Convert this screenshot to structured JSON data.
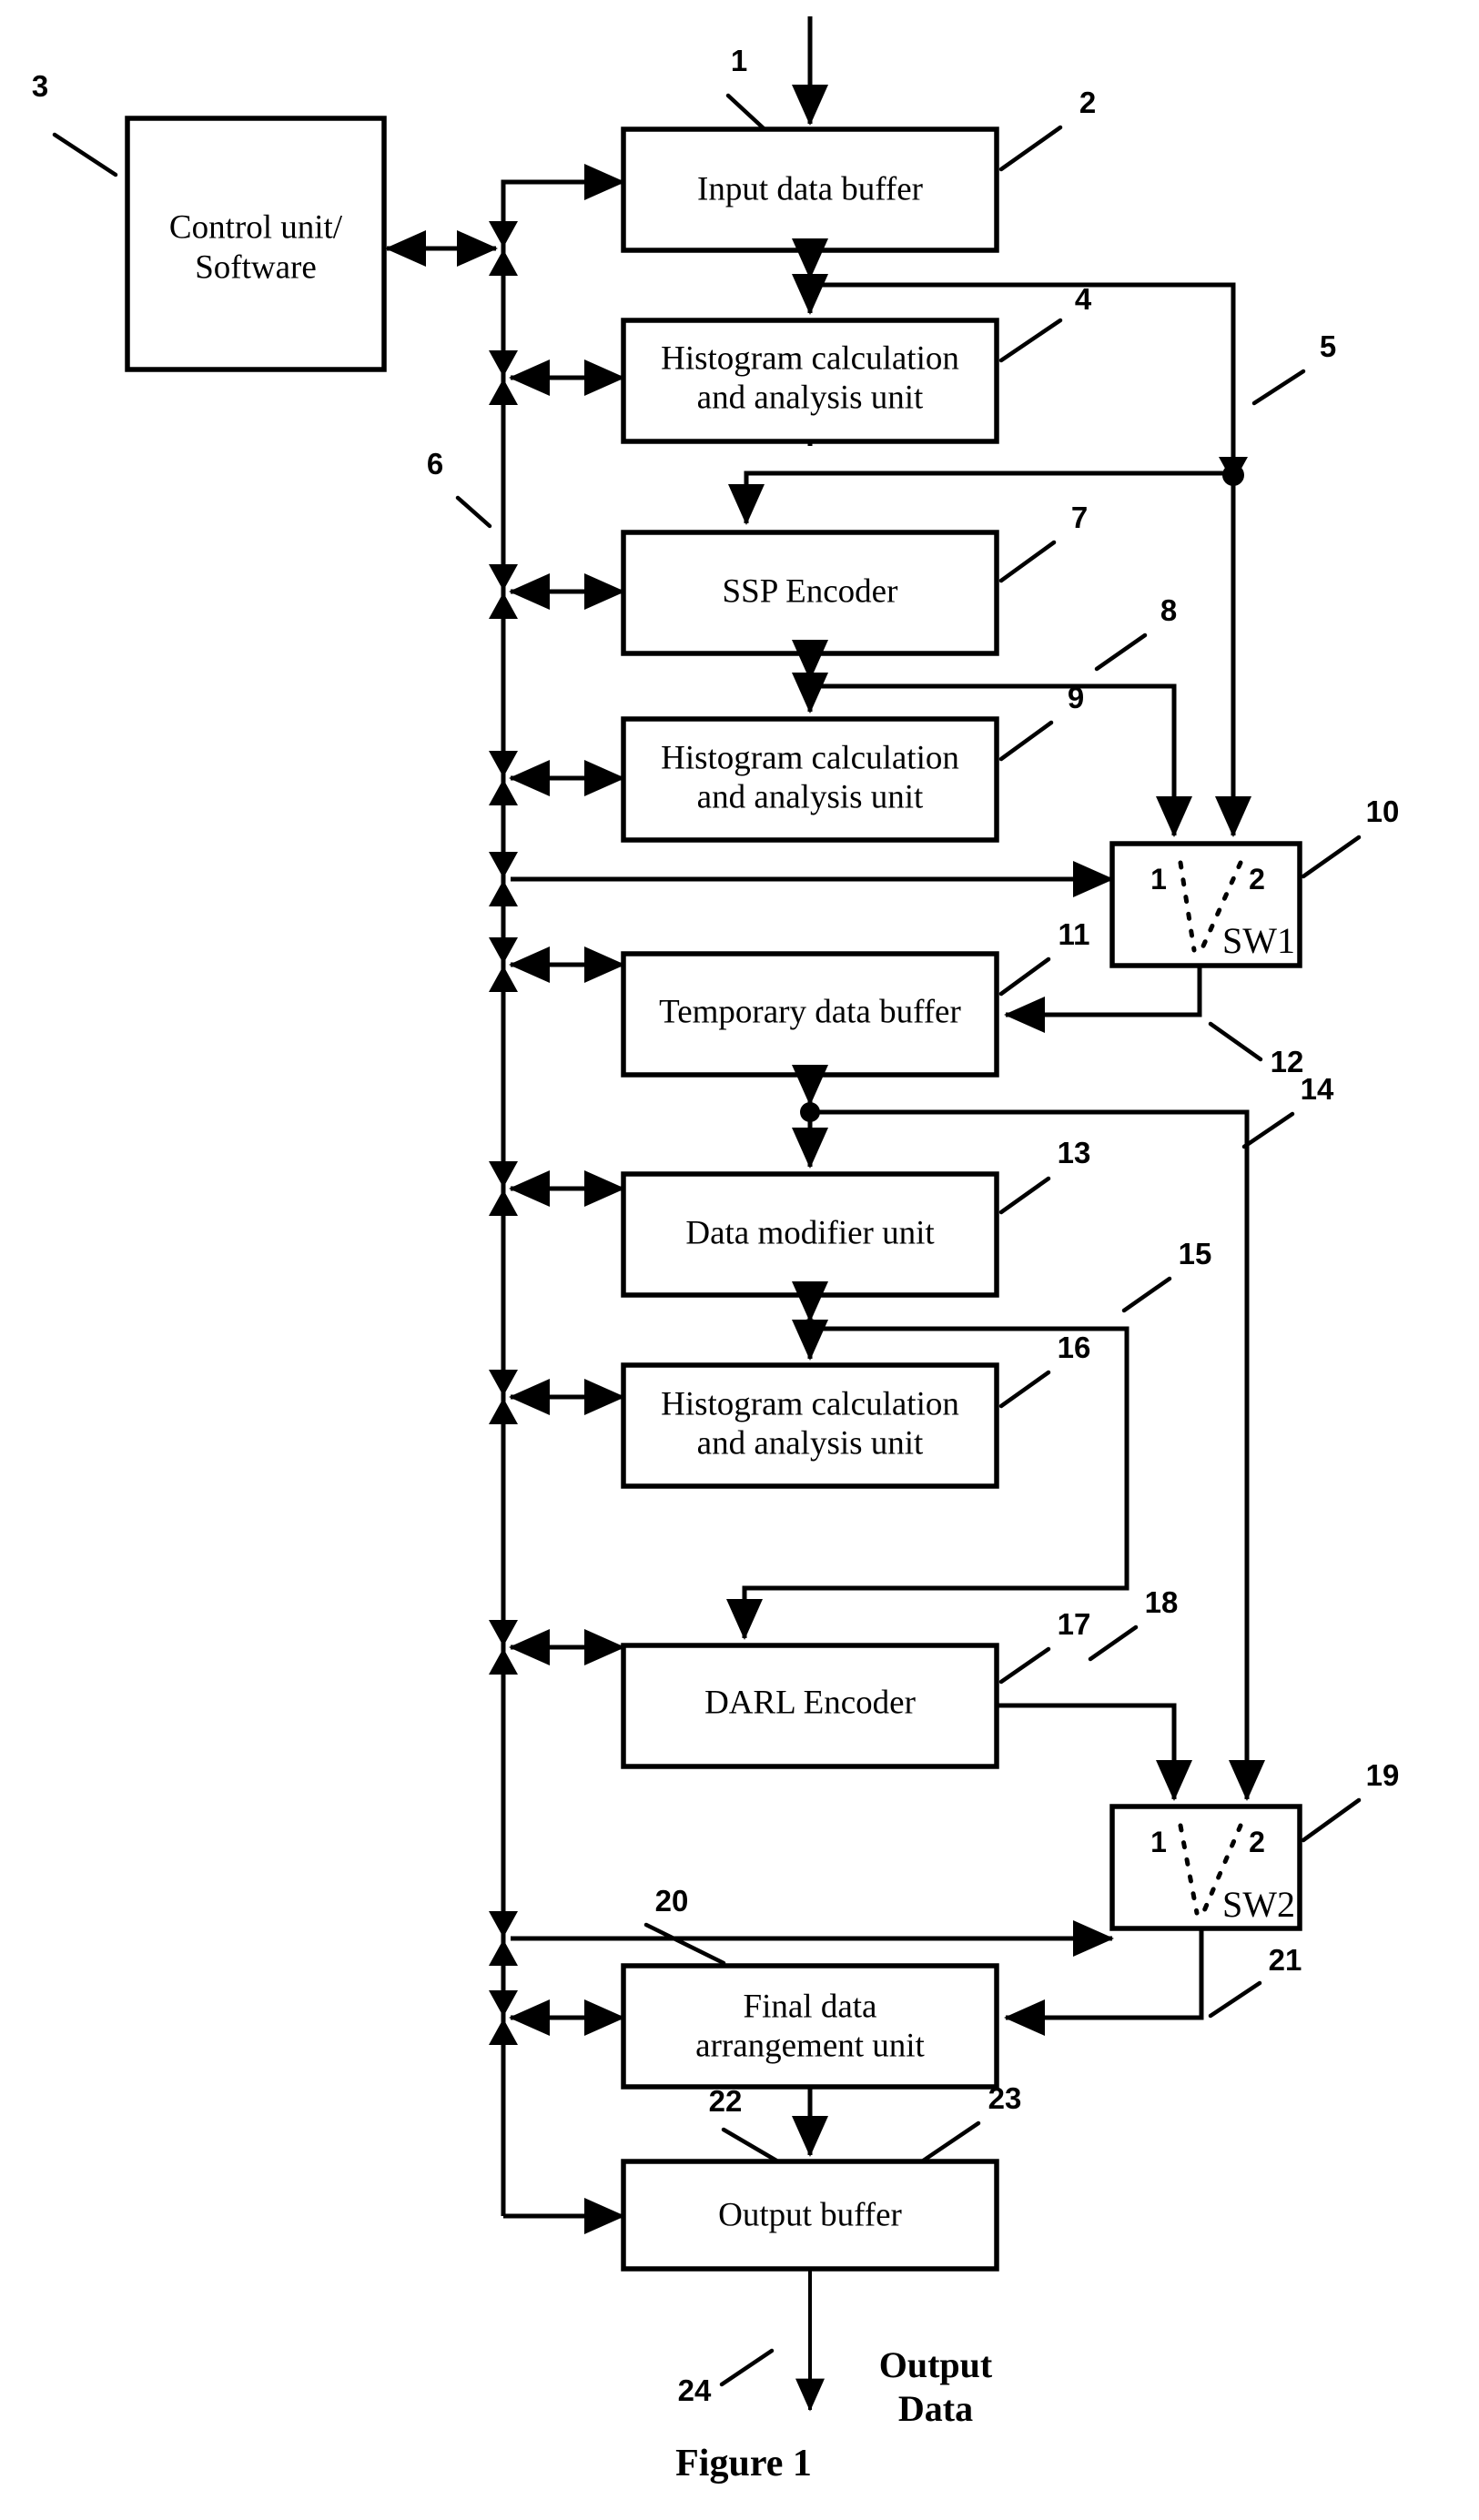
{
  "figure": {
    "caption": "Figure 1",
    "input_label": "",
    "output_label_line1": "Output",
    "output_label_line2": "Data"
  },
  "blocks": [
    {
      "id": "control-unit",
      "ref": "3",
      "line1": "Control unit/",
      "line2": "Software"
    },
    {
      "id": "input-data-buffer",
      "ref": "2",
      "line1": "Input data buffer",
      "line2": ""
    },
    {
      "id": "histogram-1",
      "ref": "4",
      "line1": "Histogram calculation",
      "line2": "and analysis unit"
    },
    {
      "id": "ssp-encoder",
      "ref": "7",
      "line1": "SSP Encoder",
      "line2": ""
    },
    {
      "id": "histogram-2",
      "ref": "9",
      "line1": "Histogram calculation",
      "line2": "and analysis unit"
    },
    {
      "id": "temporary-data-buffer",
      "ref": "11",
      "line1": "Temporary data buffer",
      "line2": ""
    },
    {
      "id": "data-modifier-unit",
      "ref": "13",
      "line1": "Data modifier unit",
      "line2": ""
    },
    {
      "id": "histogram-3",
      "ref": "16",
      "line1": "Histogram calculation",
      "line2": "and analysis unit"
    },
    {
      "id": "darl-encoder",
      "ref": "17",
      "line1": "DARL Encoder",
      "line2": ""
    },
    {
      "id": "final-data-arrangement",
      "ref": "20",
      "line1": "Final data",
      "line2": "arrangement unit"
    },
    {
      "id": "output-buffer",
      "ref": "23",
      "line1": "Output buffer",
      "line2": ""
    }
  ],
  "switches": [
    {
      "id": "sw1",
      "ref": "10",
      "name": "SW1",
      "port1": "1",
      "port2": "2"
    },
    {
      "id": "sw2",
      "ref": "19",
      "name": "SW2",
      "port1": "1",
      "port2": "2"
    }
  ],
  "reference_numerals": {
    "input_arrow": "1",
    "input_data_buffer": "2",
    "control_unit": "3",
    "histogram_1": "4",
    "bypass_line_5": "5",
    "control_bus_6": "6",
    "ssp_encoder": "7",
    "ssp_branch_8": "8",
    "histogram_2": "9",
    "sw1": "10",
    "temporary_data_buffer": "11",
    "sw1_output_12": "12",
    "data_modifier_unit": "13",
    "bypass_line_14": "14",
    "modifier_branch_15": "15",
    "histogram_3": "16",
    "darl_encoder": "17",
    "darl_branch_18": "18",
    "sw2": "19",
    "final_data_arrangement": "20",
    "sw2_output_21": "21",
    "final_output_22": "22",
    "output_buffer": "23",
    "output_arrow_24": "24"
  },
  "colors": {
    "stroke": "#000000",
    "background": "#ffffff"
  }
}
